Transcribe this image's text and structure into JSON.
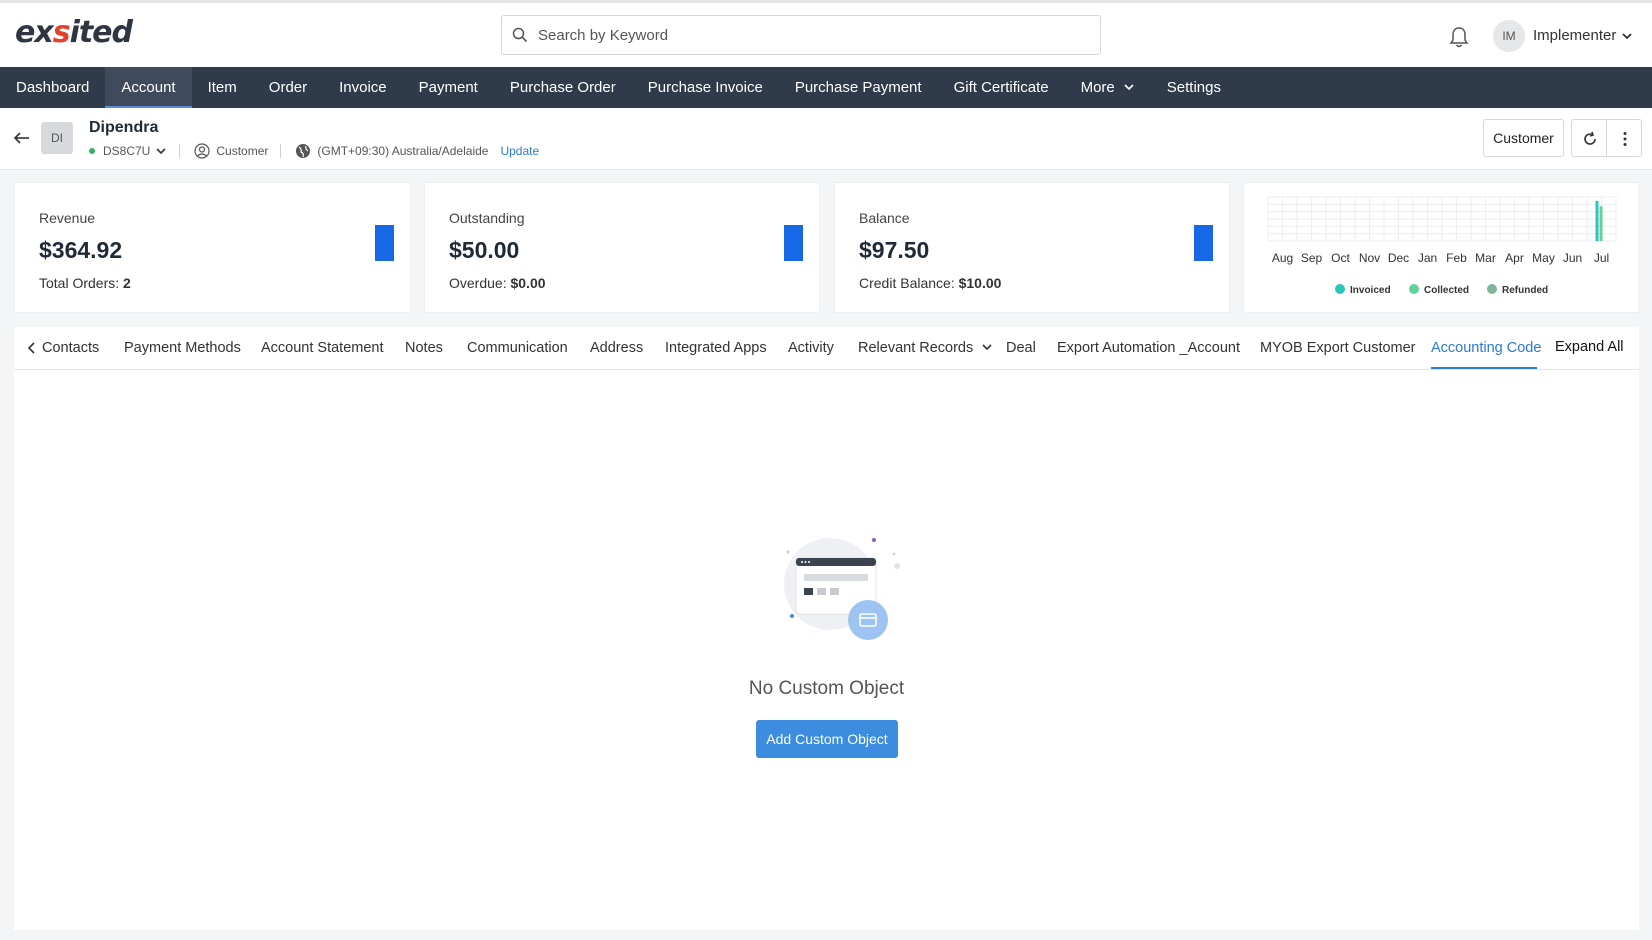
{
  "header": {
    "logo": {
      "part1": "ex",
      "accent": "s",
      "part2": "ited"
    },
    "search_placeholder": "Search by Keyword",
    "user_initials": "IM",
    "user_name": "Implementer"
  },
  "nav": {
    "items": [
      {
        "label": "Dashboard"
      },
      {
        "label": "Account",
        "active": true
      },
      {
        "label": "Item"
      },
      {
        "label": "Order"
      },
      {
        "label": "Invoice"
      },
      {
        "label": "Payment"
      },
      {
        "label": "Purchase Order"
      },
      {
        "label": "Purchase Invoice"
      },
      {
        "label": "Purchase Payment"
      },
      {
        "label": "Gift Certificate"
      },
      {
        "label": "More"
      },
      {
        "label": "Settings"
      }
    ]
  },
  "account": {
    "initials": "DI",
    "name": "Dipendra",
    "code": "DS8C7U",
    "type": "Customer",
    "timezone": "(GMT+09:30) Australia/Adelaide",
    "update_label": "Update",
    "customer_button": "Customer"
  },
  "cards": [
    {
      "label": "Revenue",
      "value": "$364.92",
      "sub_label": "Total Orders: ",
      "sub_value": "2"
    },
    {
      "label": "Outstanding",
      "value": "$50.00",
      "sub_label": "Overdue: ",
      "sub_value": "$0.00"
    },
    {
      "label": "Balance",
      "value": "$97.50",
      "sub_label": "Credit Balance: ",
      "sub_value": "$10.00"
    }
  ],
  "chart_data": {
    "type": "bar",
    "categories": [
      "Aug",
      "Sep",
      "Oct",
      "Nov",
      "Dec",
      "Jan",
      "Feb",
      "Mar",
      "Apr",
      "May",
      "Jun",
      "Jul"
    ],
    "series": [
      {
        "name": "Invoiced",
        "color": "#28c7b7",
        "values": [
          0,
          0,
          0,
          0,
          0,
          0,
          0,
          0,
          0,
          0,
          0,
          364.92
        ]
      },
      {
        "name": "Collected",
        "color": "#5fd39a",
        "values": [
          0,
          0,
          0,
          0,
          0,
          0,
          0,
          0,
          0,
          0,
          0,
          314.92
        ]
      },
      {
        "name": "Refunded",
        "color": "#7fb59a",
        "values": [
          0,
          0,
          0,
          0,
          0,
          0,
          0,
          0,
          0,
          0,
          0,
          0
        ]
      }
    ],
    "ylim": [
      0,
      400
    ],
    "grid": true,
    "legend_position": "bottom"
  },
  "tabs": {
    "items": [
      {
        "label": "Contacts"
      },
      {
        "label": "Payment Methods"
      },
      {
        "label": "Account Statement"
      },
      {
        "label": "Notes"
      },
      {
        "label": "Communication"
      },
      {
        "label": "Address"
      },
      {
        "label": "Integrated Apps"
      },
      {
        "label": "Activity"
      },
      {
        "label": "Relevant Records"
      },
      {
        "label": "Deal"
      },
      {
        "label": "Export Automation _Account"
      },
      {
        "label": "MYOB Export Customer"
      },
      {
        "label": "Accounting Code",
        "active": true
      }
    ],
    "expand_all": "Expand All"
  },
  "empty_state": {
    "title": "No Custom Object",
    "button": "Add Custom Object"
  },
  "colors": {
    "nav_bg": "#2f3a4a",
    "accent": "#2a7bd1",
    "card_bar": "#1768e6",
    "primary_button": "#3c8ce0"
  }
}
